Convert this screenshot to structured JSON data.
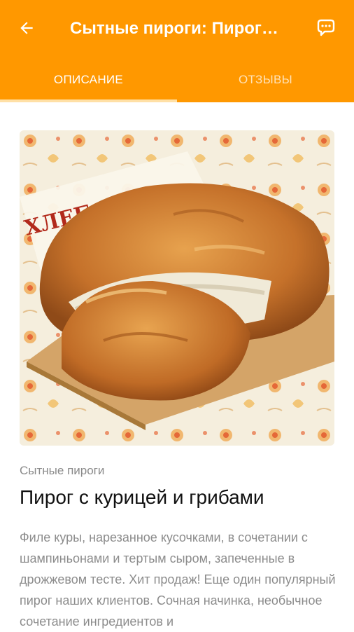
{
  "appbar": {
    "title": "Сытные пироги: Пирог с курицей и грибами",
    "back_icon": "arrow-back-icon",
    "chat_icon": "chat-bubble-icon",
    "color": "#FF9800"
  },
  "tabs": [
    {
      "label": "ОПИСАНИЕ",
      "active": true
    },
    {
      "label": "ОТЗЫВЫ",
      "active": false
    }
  ],
  "product": {
    "image_description_icon": "pie-photo",
    "category": "Сытные пироги",
    "name": "Пирог с курицей и грибами",
    "description": "Филе куры, нарезанное кусочками, в сочетании с шампиньонами и тертым сыром, запеченные в дрожжевом тесте. Хит продаж! Еще один популярный пирог наших клиентов. Сочная начинка, необычное сочетание ингредиентов и"
  }
}
